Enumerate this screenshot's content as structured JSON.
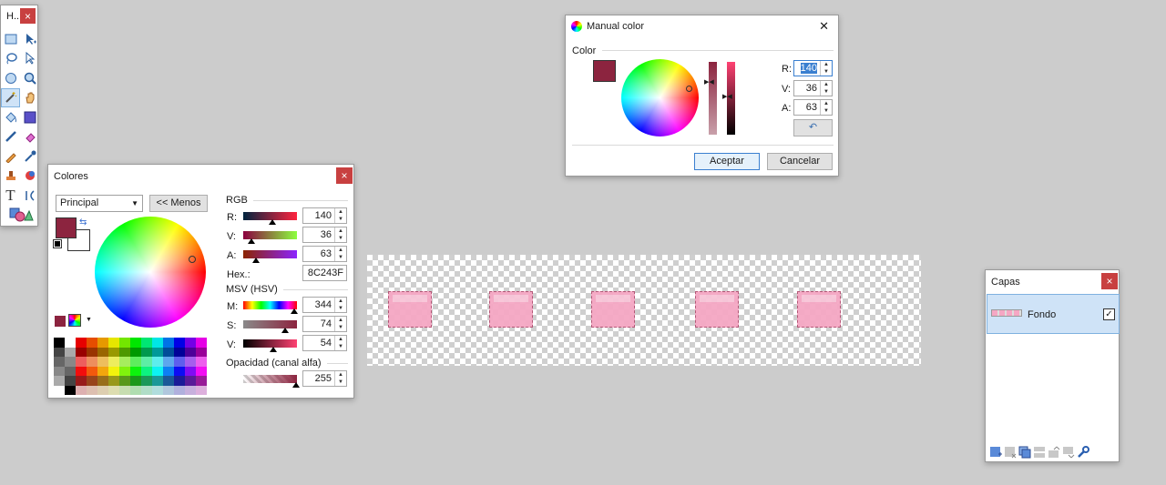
{
  "tools": {
    "title": "H...",
    "close": "×"
  },
  "colores": {
    "title": "Colores",
    "close": "×",
    "dropdown_value": "Principal",
    "less_button": "<< Menos",
    "rgb_header": "RGB",
    "r_label": "R:",
    "g_label": "V:",
    "b_label": "A:",
    "r_value": "140",
    "g_value": "36",
    "b_value": "63",
    "hex_label": "Hex.:",
    "hex_value": "8C243F",
    "hsv_header": "MSV (HSV)",
    "h_label": "M:",
    "s_label": "S:",
    "v_label": "V:",
    "h_value": "344",
    "s_value": "74",
    "v_value": "54",
    "opacity_header": "Opacidad (canal alfa)",
    "opacity_value": "255",
    "primary_color": "#8C243F"
  },
  "manual": {
    "title": "Manual color",
    "close": "✕",
    "group_label": "Color",
    "r_label": "R:",
    "g_label": "V:",
    "b_label": "A:",
    "r_value": "140",
    "g_value": "36",
    "b_value": "63",
    "ok_button": "Aceptar",
    "cancel_button": "Cancelar"
  },
  "capas": {
    "title": "Capas",
    "close": "×",
    "layer_name": "Fondo",
    "layer_checked": "✓"
  }
}
